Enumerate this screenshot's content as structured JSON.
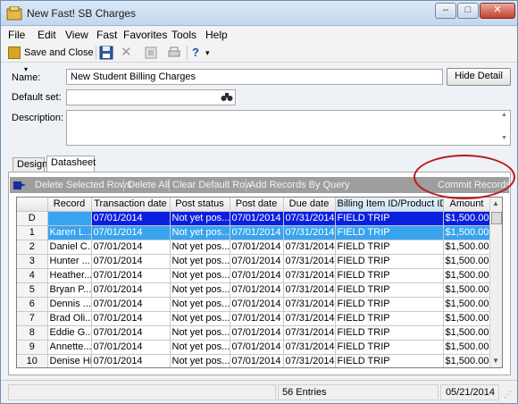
{
  "window": {
    "title": "New Fast! SB Charges"
  },
  "menu": [
    {
      "label": "File"
    },
    {
      "label": "Edit"
    },
    {
      "label": "View"
    },
    {
      "label": "Fast"
    },
    {
      "label": "Favorites"
    },
    {
      "label": "Tools"
    },
    {
      "label": "Help"
    }
  ],
  "toolbar": {
    "save_close": "Save and Close",
    "help_glyph": "?"
  },
  "form": {
    "name_label": "Name:",
    "name_value": "New Student Billing Charges",
    "default_set_label": "Default set:",
    "default_set_value": "",
    "description_label": "Description:",
    "description_value": "",
    "hide_detail": "Hide Detail"
  },
  "tabs": [
    {
      "label": "Design"
    },
    {
      "label": "Datasheet"
    }
  ],
  "ds_actions": {
    "delete_selected": "Delete Selected Rows",
    "delete_all": "Delete All",
    "clear_default": "Clear Default Row",
    "add_by_query": "Add Records By Query",
    "commit": "Commit Records"
  },
  "grid": {
    "columns": [
      "Record",
      "Transaction date",
      "Post status",
      "Post date",
      "Due date",
      "Billing Item ID/Product ID",
      "Amount"
    ],
    "rows": [
      {
        "hdr": "D",
        "c": [
          "",
          "07/01/2014",
          "Not yet pos...",
          "07/01/2014",
          "07/31/2014",
          "FIELD TRIP",
          "$1,500.00"
        ]
      },
      {
        "hdr": "1",
        "c": [
          "Karen L...",
          "07/01/2014",
          "Not yet pos...",
          "07/01/2014",
          "07/31/2014",
          "FIELD TRIP",
          "$1,500.00"
        ]
      },
      {
        "hdr": "2",
        "c": [
          "Daniel C...",
          "07/01/2014",
          "Not yet pos...",
          "07/01/2014",
          "07/31/2014",
          "FIELD TRIP",
          "$1,500.00"
        ]
      },
      {
        "hdr": "3",
        "c": [
          "Hunter ...",
          "07/01/2014",
          "Not yet pos...",
          "07/01/2014",
          "07/31/2014",
          "FIELD TRIP",
          "$1,500.00"
        ]
      },
      {
        "hdr": "4",
        "c": [
          "Heather...",
          "07/01/2014",
          "Not yet pos...",
          "07/01/2014",
          "07/31/2014",
          "FIELD TRIP",
          "$1,500.00"
        ]
      },
      {
        "hdr": "5",
        "c": [
          "Bryan P...",
          "07/01/2014",
          "Not yet pos...",
          "07/01/2014",
          "07/31/2014",
          "FIELD TRIP",
          "$1,500.00"
        ]
      },
      {
        "hdr": "6",
        "c": [
          "Dennis ...",
          "07/01/2014",
          "Not yet pos...",
          "07/01/2014",
          "07/31/2014",
          "FIELD TRIP",
          "$1,500.00"
        ]
      },
      {
        "hdr": "7",
        "c": [
          "Brad Oli...",
          "07/01/2014",
          "Not yet pos...",
          "07/01/2014",
          "07/31/2014",
          "FIELD TRIP",
          "$1,500.00"
        ]
      },
      {
        "hdr": "8",
        "c": [
          "Eddie G...",
          "07/01/2014",
          "Not yet pos...",
          "07/01/2014",
          "07/31/2014",
          "FIELD TRIP",
          "$1,500.00"
        ]
      },
      {
        "hdr": "9",
        "c": [
          "Annette...",
          "07/01/2014",
          "Not yet pos...",
          "07/01/2014",
          "07/31/2014",
          "FIELD TRIP",
          "$1,500.00"
        ]
      },
      {
        "hdr": "10",
        "c": [
          "Denise Hill",
          "07/01/2014",
          "Not yet pos...",
          "07/01/2014",
          "07/31/2014",
          "FIELD TRIP",
          "$1,500.00"
        ]
      }
    ]
  },
  "status": {
    "entries": "56 Entries",
    "date": "05/21/2014"
  },
  "colors": {
    "selected_row": "#0b1fe0",
    "highlight_row": "#39a3f0",
    "annotation": "#b81c1c"
  }
}
